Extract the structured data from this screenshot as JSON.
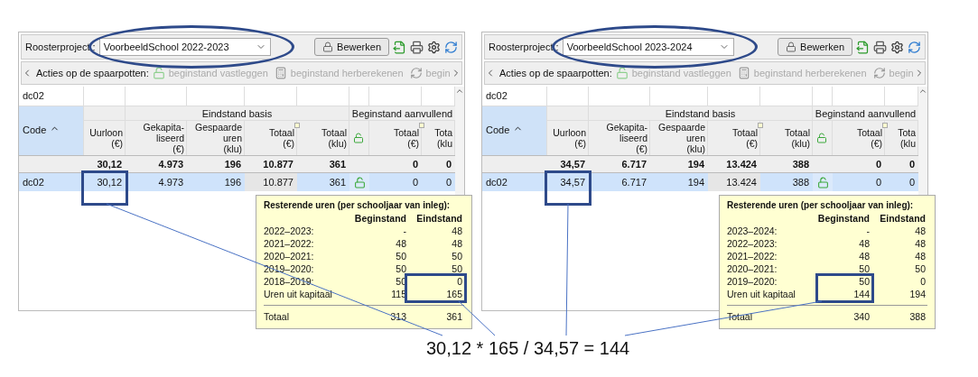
{
  "screens": [
    {
      "project_label": "Roosterproject :",
      "project_value": "VoorbeeldSchool 2022-2023",
      "edit_button": "Bewerken",
      "actions_label": "Acties op de spaarpotten:",
      "actions": [
        {
          "label": "beginstand vastleggen",
          "kind": "lock",
          "disabled": true
        },
        {
          "label": "beginstand herberekenen",
          "kind": "calc",
          "disabled": true
        },
        {
          "label": "begin",
          "kind": "refresh",
          "disabled": true
        }
      ],
      "filter": "dc02",
      "group_headers": [
        "Eindstand basis",
        "Beginstand aanvullend"
      ],
      "columns": [
        {
          "kind": "text",
          "label": "Code",
          "sorted": true
        },
        {
          "kind": "text",
          "label": "Uurloon\n(€)"
        },
        {
          "kind": "text",
          "label": "Gekapita-\nliseerd\n(€)"
        },
        {
          "kind": "text",
          "label": "Gespaarde\nuren\n(klu)"
        },
        {
          "kind": "text",
          "label": "Totaal\n(€)"
        },
        {
          "kind": "text",
          "label": "Totaal\n(klu)"
        },
        {
          "kind": "lock"
        },
        {
          "kind": "text",
          "label": "Totaal\n(€)"
        },
        {
          "kind": "text",
          "label": "Tota\n(klu"
        }
      ],
      "totals_row": [
        "30,12",
        "4.973",
        "196",
        "10.877",
        "361",
        "0",
        "0"
      ],
      "data_row": {
        "selected": true,
        "cells": [
          "dc02",
          "30,12",
          "4.973",
          "196",
          "10.877",
          "361",
          "0",
          "0"
        ]
      },
      "tooltip": {
        "title": "Resterende uren (per schooljaar van inleg):",
        "headers": [
          "Beginstand",
          "Eindstand"
        ],
        "rows": [
          [
            "2022–2023:",
            "-",
            "48"
          ],
          [
            "2021–2022:",
            "48",
            "48"
          ],
          [
            "2020–2021:",
            "50",
            "50"
          ],
          [
            "2019–2020:",
            "50",
            "50"
          ],
          [
            "2018–2019:",
            "50",
            "0"
          ],
          [
            "Uren uit kapitaal",
            "115",
            "165"
          ]
        ],
        "total": [
          "Totaal",
          "313",
          "361"
        ]
      }
    },
    {
      "project_label": "Roosterproject :",
      "project_value": "VoorbeeldSchool 2023-2024",
      "edit_button": "Bewerken",
      "actions_label": "Acties op de spaarpotten:",
      "actions": [
        {
          "label": "beginstand vastleggen",
          "kind": "lock",
          "disabled": true
        },
        {
          "label": "beginstand herberekenen",
          "kind": "calc",
          "disabled": true
        },
        {
          "label": "begin",
          "kind": "refresh",
          "disabled": true
        }
      ],
      "filter": "dc02",
      "group_headers": [
        "Eindstand basis",
        "Beginstand aanvullend"
      ],
      "columns": [
        {
          "kind": "text",
          "label": "Code",
          "sorted": true
        },
        {
          "kind": "text",
          "label": "Uurloon\n(€)"
        },
        {
          "kind": "text",
          "label": "Gekapita-\nliseerd\n(€)"
        },
        {
          "kind": "text",
          "label": "Gespaarde\nuren\n(klu)"
        },
        {
          "kind": "text",
          "label": "Totaal\n(€)"
        },
        {
          "kind": "text",
          "label": "Totaal\n(klu)"
        },
        {
          "kind": "lock"
        },
        {
          "kind": "text",
          "label": "Totaal\n(€)"
        },
        {
          "kind": "text",
          "label": "Tota\n(klu"
        }
      ],
      "totals_row": [
        "34,57",
        "6.717",
        "194",
        "13.424",
        "388",
        "0",
        "0"
      ],
      "data_row": {
        "selected": true,
        "cells": [
          "dc02",
          "34,57",
          "6.717",
          "194",
          "13.424",
          "388",
          "0",
          "0"
        ]
      },
      "tooltip": {
        "title": "Resterende uren (per schooljaar van inleg):",
        "headers": [
          "Beginstand",
          "Eindstand"
        ],
        "rows": [
          [
            "2023–2024:",
            "-",
            "48"
          ],
          [
            "2022–2023:",
            "48",
            "48"
          ],
          [
            "2021–2022:",
            "48",
            "48"
          ],
          [
            "2020–2021:",
            "50",
            "50"
          ],
          [
            "2019–2020:",
            "50",
            "0"
          ],
          [
            "Uren uit kapitaal",
            "144",
            "194"
          ]
        ],
        "total": [
          "Totaal",
          "340",
          "388"
        ]
      }
    }
  ],
  "formula": "30,12 * 165 / 34,57 = 144"
}
